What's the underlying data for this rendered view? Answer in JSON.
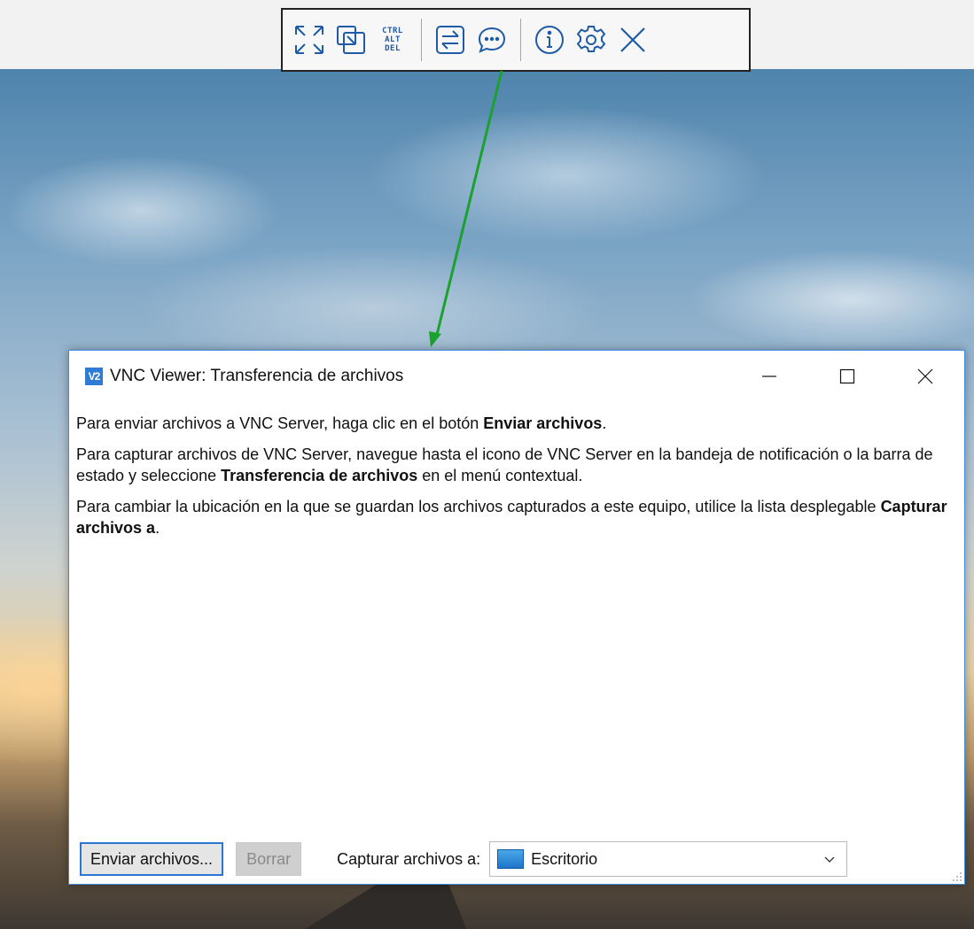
{
  "toolbar": {
    "buttons": [
      {
        "icon": "fullscreen-icon"
      },
      {
        "icon": "scale-icon"
      },
      {
        "icon": "ctrl-alt-del-icon",
        "lines": [
          "CTRL",
          "ALT",
          "DEL"
        ]
      },
      {
        "icon": "file-transfer-icon"
      },
      {
        "icon": "chat-icon"
      },
      {
        "icon": "info-icon"
      },
      {
        "icon": "settings-icon"
      },
      {
        "icon": "close-icon"
      }
    ],
    "accent": "#1f5aa6"
  },
  "annotation": {
    "arrow_color": "#1aa12f"
  },
  "dialog": {
    "app_icon_text": "V2",
    "title": "VNC Viewer: Transferencia de archivos",
    "paragraphs": [
      {
        "text_1": "Para enviar archivos a VNC Server, haga clic en el botón ",
        "bold_1": "Enviar archivos",
        "text_2": "."
      },
      {
        "text_1": "Para capturar archivos de VNC Server, navegue hasta el icono de VNC Server en la bandeja de notificación o la barra de estado y seleccione ",
        "bold_1": "Transferencia de archivos",
        "text_2": " en el menú contextual."
      },
      {
        "text_1": "Para cambiar la ubicación en la que se guardan los archivos capturados a este equipo, utilice la lista desplegable ",
        "bold_1": "Capturar archivos a",
        "text_2": "."
      }
    ],
    "send_button": "Enviar archivos...",
    "clear_button": "Borrar",
    "capture_label": "Capturar archivos a:",
    "capture_value": "Escritorio",
    "accent": "#2b78d4"
  }
}
